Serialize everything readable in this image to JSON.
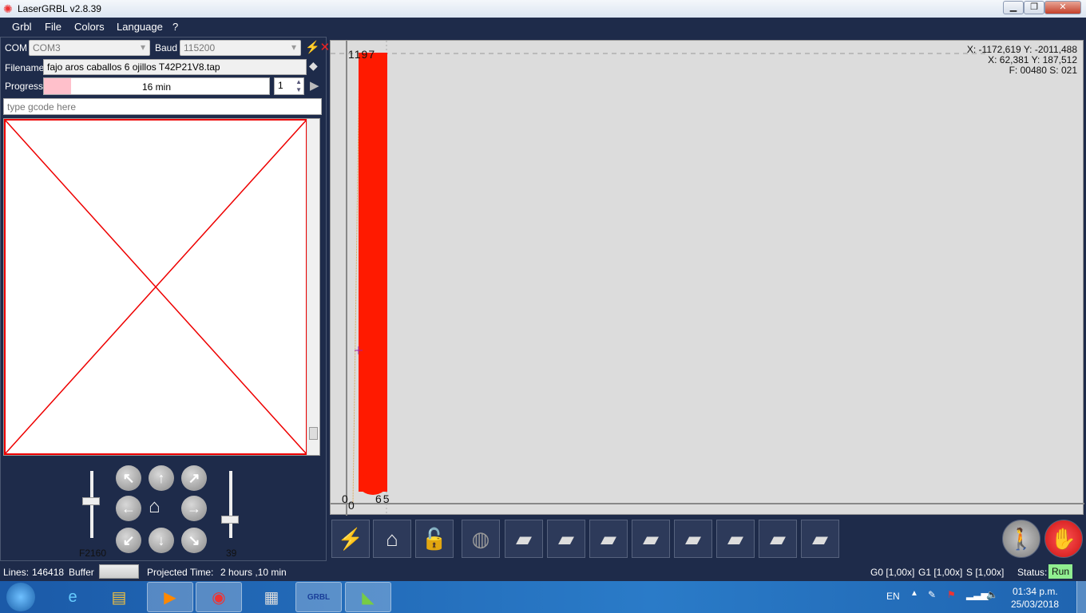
{
  "window": {
    "title": "LaserGRBL v2.8.39",
    "logo_icon": "laser-logo-icon"
  },
  "menu": [
    "Grbl",
    "File",
    "Colors",
    "Language",
    "?"
  ],
  "connection": {
    "com_label": "COM",
    "com_value": "COM3",
    "baud_label": "Baud",
    "baud_value": "115200"
  },
  "file": {
    "filename_label": "Filename",
    "filename": "fajo aros caballos 6 ojillos T42P21V8.tap",
    "progress_label": "Progress",
    "progress_text": "16 min",
    "progress_fraction": 0.12,
    "passes": "1"
  },
  "gcode": {
    "placeholder": "type gcode here"
  },
  "jog": {
    "speed_label": "F2160",
    "speed_level": 0.55,
    "step_label": "39",
    "step_level": 0.25
  },
  "preview": {
    "coord1": "X: -1172,619 Y: -2011,488",
    "coord2": "X: 62,381 Y: 187,512",
    "coord3": "F: 00480 S: 021",
    "top_label": "1197",
    "origin_x": "0",
    "origin_y": "0",
    "right_label": "65"
  },
  "toolbar": [
    "lightning-icon",
    "home-search-icon",
    "unlock-icon",
    "globe-icon",
    "custom-button-1",
    "custom-button-2",
    "custom-button-3",
    "custom-button-4",
    "custom-button-5",
    "custom-button-6",
    "custom-button-7",
    "custom-button-8"
  ],
  "status": {
    "lines_label": "Lines:",
    "lines": "146418",
    "buffer_label": "Buffer",
    "projected_label": "Projected Time:",
    "projected": "2 hours ,10 min",
    "g0": "G0 [1,00x]",
    "g1": "G1 [1,00x]",
    "s": "S [1,00x]",
    "status_label": "Status:",
    "status": "Run",
    "status_color": "#90ee90"
  },
  "taskbar": {
    "lang": "EN",
    "time": "01:34 p.m.",
    "date": "25/03/2018"
  },
  "colors": {
    "accent": "#1e2b4a",
    "path": "#ff1a00"
  }
}
